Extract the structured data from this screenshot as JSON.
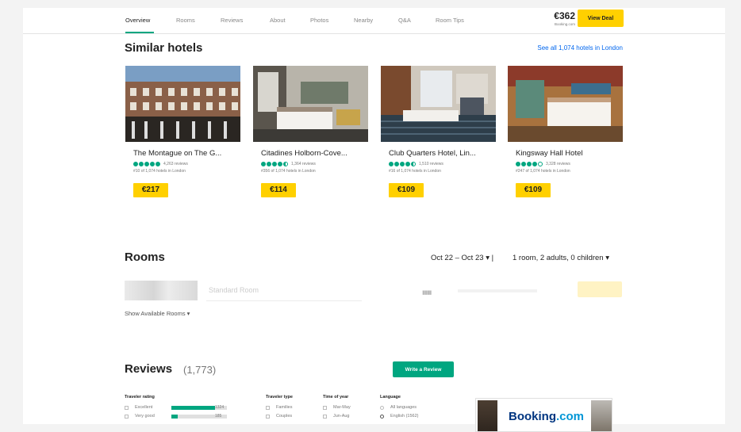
{
  "nav": {
    "tabs": [
      "Overview",
      "Rooms",
      "Reviews",
      "About",
      "Photos",
      "Nearby",
      "Q&A",
      "Room Tips"
    ],
    "price": "€362",
    "price_source": "Booking.com",
    "deal_label": "View Deal"
  },
  "similar": {
    "title": "Similar hotels",
    "see_all": "See all 1,074 hotels in London",
    "hotels": [
      {
        "name": "The Montague on The G...",
        "rating": 5,
        "reviews": "4,263 reviews",
        "rank": "#10 of 1,074 hotels in London",
        "price": "€217"
      },
      {
        "name": "Citadines Holborn-Cove...",
        "rating": 4.5,
        "reviews": "1,364 reviews",
        "rank": "#356 of 1,074 hotels in London",
        "price": "€114"
      },
      {
        "name": "Club Quarters Hotel, Lin...",
        "rating": 4.5,
        "reviews": "1,510 reviews",
        "rank": "#16 of 1,074 hotels in London",
        "price": "€109"
      },
      {
        "name": "Kingsway Hall Hotel",
        "rating": 4,
        "reviews": "3,328 reviews",
        "rank": "#247 of 1,074 hotels in London",
        "price": "€109"
      }
    ]
  },
  "rooms": {
    "title": "Rooms",
    "dates": "Oct 22 – Oct 23",
    "guests": "1 room, 2 adults, 0 children",
    "placeholder_room": "Standard Room",
    "show_available": "Show Available Rooms"
  },
  "reviews": {
    "title": "Reviews",
    "count": "(1,773)",
    "write_label": "Write a Review",
    "traveler_rating": {
      "heading": "Traveler rating",
      "rows": [
        {
          "label": "Excellent",
          "count": "1324",
          "fraction": 0.78
        },
        {
          "label": "Very good",
          "count": "185",
          "fraction": 0.11
        }
      ]
    },
    "traveler_type": {
      "heading": "Traveler type",
      "options": [
        "Families",
        "Couples"
      ]
    },
    "time_of_year": {
      "heading": "Time of year",
      "options": [
        "Mar-May",
        "Jun-Aug"
      ]
    },
    "language": {
      "heading": "Language",
      "options": [
        "All languages",
        "English (1562)"
      ],
      "selected": "English (1562)"
    }
  },
  "ad": {
    "brand": "Booking",
    "brand_suffix": ".com"
  },
  "colors": {
    "accent_green": "#00a680",
    "deal_yellow": "#ffd000",
    "link_blue": "#0066ee"
  }
}
